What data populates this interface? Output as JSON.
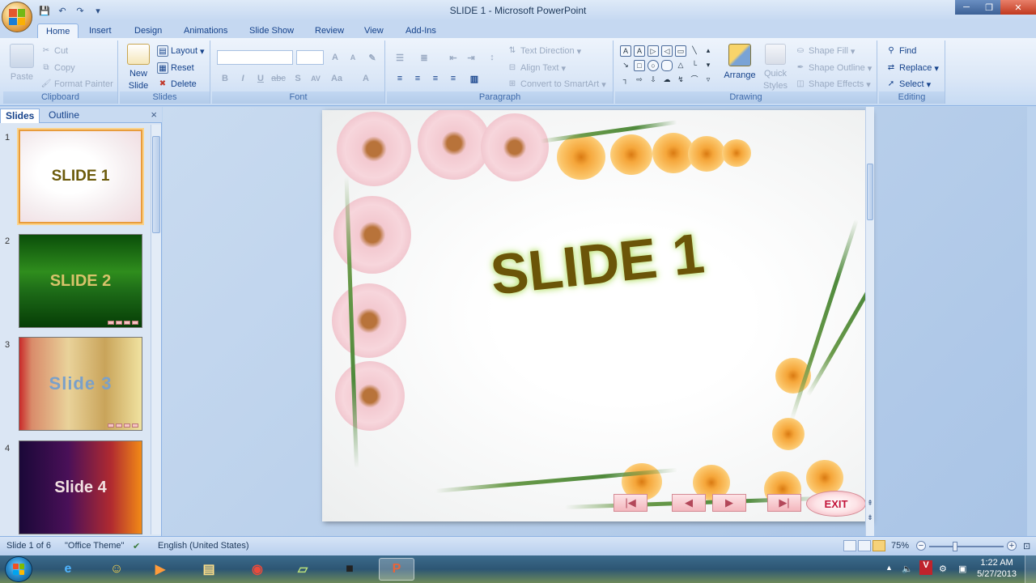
{
  "window": {
    "title": "SLIDE 1 - Microsoft PowerPoint",
    "controls": {
      "minimize": "─",
      "maximize": "❐",
      "close": "✕"
    }
  },
  "quick_access": [
    {
      "name": "save-icon",
      "glyph": "💾"
    },
    {
      "name": "undo-icon",
      "glyph": "↶"
    },
    {
      "name": "redo-icon",
      "glyph": "↷"
    },
    {
      "name": "customize-qat-icon",
      "glyph": "▾"
    }
  ],
  "tabs": [
    "Home",
    "Insert",
    "Design",
    "Animations",
    "Slide Show",
    "Review",
    "View",
    "Add-Ins"
  ],
  "ribbon": {
    "clipboard": {
      "label": "Clipboard",
      "paste": "Paste",
      "cut": "Cut",
      "copy": "Copy",
      "format_painter": "Format Painter"
    },
    "slides": {
      "label": "Slides",
      "new_slide_line1": "New",
      "new_slide_line2": "Slide",
      "layout": "Layout",
      "reset": "Reset",
      "delete": "Delete"
    },
    "font": {
      "label": "Font",
      "bold": "B",
      "italic": "I",
      "underline": "U",
      "strike": "abc",
      "shadow": "S",
      "spacing": "AV",
      "case": "Aa",
      "color": "A",
      "grow": "A",
      "shrink": "A"
    },
    "paragraph": {
      "label": "Paragraph",
      "text_direction": "Text Direction",
      "align_text": "Align Text",
      "convert_smartart": "Convert to SmartArt"
    },
    "drawing": {
      "label": "Drawing",
      "arrange": "Arrange",
      "quick_styles_line1": "Quick",
      "quick_styles_line2": "Styles",
      "shape_fill": "Shape Fill",
      "shape_outline": "Shape Outline",
      "shape_effects": "Shape Effects"
    },
    "editing": {
      "label": "Editing",
      "find": "Find",
      "replace": "Replace",
      "select": "Select"
    }
  },
  "left_panel": {
    "tabs": [
      "Slides",
      "Outline"
    ],
    "close": "×",
    "thumbnails": [
      {
        "num": "1",
        "text": "SLIDE 1"
      },
      {
        "num": "2",
        "text": "SLIDE 2"
      },
      {
        "num": "3",
        "text": "Slide 3"
      },
      {
        "num": "4",
        "text": "Slide 4"
      }
    ]
  },
  "slide": {
    "title": "SLIDE 1",
    "nav": {
      "first": "|◀",
      "prev": "◀",
      "next": "▶",
      "last": "▶|"
    },
    "exit": "EXIT"
  },
  "status": {
    "slide_info": "Slide 1 of 6",
    "theme": "\"Office Theme\"",
    "language": "English (United States)",
    "zoom": "75%",
    "zoom_minus": "−",
    "zoom_plus": "+"
  },
  "taskbar": {
    "time": "1:22 AM",
    "date": "5/27/2013",
    "tray_arrow": "▲",
    "volume": "🔈"
  }
}
